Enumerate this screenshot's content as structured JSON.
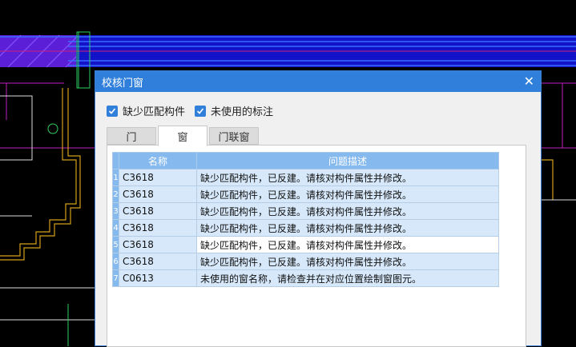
{
  "dialog": {
    "title": "校核门窗",
    "close_glyph": "✕"
  },
  "filters": [
    {
      "label": "缺少匹配构件",
      "checked": true
    },
    {
      "label": "未使用的标注",
      "checked": true
    }
  ],
  "tabs": [
    {
      "label": "门",
      "active": false
    },
    {
      "label": "窗",
      "active": true
    },
    {
      "label": "门联窗",
      "active": false
    }
  ],
  "table": {
    "columns": [
      "名称",
      "问题描述"
    ],
    "rows": [
      {
        "num": "1",
        "name": "C3618",
        "desc": "缺少匹配构件，已反建。请核对构件属性并修改。"
      },
      {
        "num": "2",
        "name": "C3618",
        "desc": "缺少匹配构件，已反建。请核对构件属性并修改。"
      },
      {
        "num": "3",
        "name": "C3618",
        "desc": "缺少匹配构件，已反建。请核对构件属性并修改。"
      },
      {
        "num": "4",
        "name": "C3618",
        "desc": "缺少匹配构件，已反建。请核对构件属性并修改。"
      },
      {
        "num": "5",
        "name": "C3618",
        "desc": "缺少匹配构件，已反建。请核对构件属性并修改。"
      },
      {
        "num": "6",
        "name": "C3618",
        "desc": "缺少匹配构件，已反建。请核对构件属性并修改。"
      },
      {
        "num": "7",
        "name": "C0613",
        "desc": "未使用的窗名称，请检查并在对应位置绘制窗图元。"
      }
    ]
  },
  "colors": {
    "accent": "#2f7fdb",
    "header": "#86b9ee",
    "row": "#d6e8fa"
  }
}
